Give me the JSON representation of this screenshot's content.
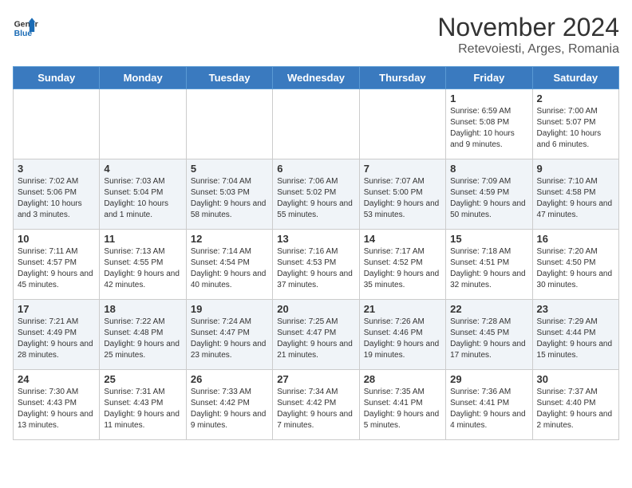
{
  "header": {
    "logo": {
      "general": "General",
      "blue": "Blue"
    },
    "title": "November 2024",
    "subtitle": "Retevoiesti, Arges, Romania"
  },
  "days_of_week": [
    "Sunday",
    "Monday",
    "Tuesday",
    "Wednesday",
    "Thursday",
    "Friday",
    "Saturday"
  ],
  "weeks": [
    [
      {
        "day": "",
        "info": ""
      },
      {
        "day": "",
        "info": ""
      },
      {
        "day": "",
        "info": ""
      },
      {
        "day": "",
        "info": ""
      },
      {
        "day": "",
        "info": ""
      },
      {
        "day": "1",
        "info": "Sunrise: 6:59 AM\nSunset: 5:08 PM\nDaylight: 10 hours and 9 minutes."
      },
      {
        "day": "2",
        "info": "Sunrise: 7:00 AM\nSunset: 5:07 PM\nDaylight: 10 hours and 6 minutes."
      }
    ],
    [
      {
        "day": "3",
        "info": "Sunrise: 7:02 AM\nSunset: 5:06 PM\nDaylight: 10 hours and 3 minutes."
      },
      {
        "day": "4",
        "info": "Sunrise: 7:03 AM\nSunset: 5:04 PM\nDaylight: 10 hours and 1 minute."
      },
      {
        "day": "5",
        "info": "Sunrise: 7:04 AM\nSunset: 5:03 PM\nDaylight: 9 hours and 58 minutes."
      },
      {
        "day": "6",
        "info": "Sunrise: 7:06 AM\nSunset: 5:02 PM\nDaylight: 9 hours and 55 minutes."
      },
      {
        "day": "7",
        "info": "Sunrise: 7:07 AM\nSunset: 5:00 PM\nDaylight: 9 hours and 53 minutes."
      },
      {
        "day": "8",
        "info": "Sunrise: 7:09 AM\nSunset: 4:59 PM\nDaylight: 9 hours and 50 minutes."
      },
      {
        "day": "9",
        "info": "Sunrise: 7:10 AM\nSunset: 4:58 PM\nDaylight: 9 hours and 47 minutes."
      }
    ],
    [
      {
        "day": "10",
        "info": "Sunrise: 7:11 AM\nSunset: 4:57 PM\nDaylight: 9 hours and 45 minutes."
      },
      {
        "day": "11",
        "info": "Sunrise: 7:13 AM\nSunset: 4:55 PM\nDaylight: 9 hours and 42 minutes."
      },
      {
        "day": "12",
        "info": "Sunrise: 7:14 AM\nSunset: 4:54 PM\nDaylight: 9 hours and 40 minutes."
      },
      {
        "day": "13",
        "info": "Sunrise: 7:16 AM\nSunset: 4:53 PM\nDaylight: 9 hours and 37 minutes."
      },
      {
        "day": "14",
        "info": "Sunrise: 7:17 AM\nSunset: 4:52 PM\nDaylight: 9 hours and 35 minutes."
      },
      {
        "day": "15",
        "info": "Sunrise: 7:18 AM\nSunset: 4:51 PM\nDaylight: 9 hours and 32 minutes."
      },
      {
        "day": "16",
        "info": "Sunrise: 7:20 AM\nSunset: 4:50 PM\nDaylight: 9 hours and 30 minutes."
      }
    ],
    [
      {
        "day": "17",
        "info": "Sunrise: 7:21 AM\nSunset: 4:49 PM\nDaylight: 9 hours and 28 minutes."
      },
      {
        "day": "18",
        "info": "Sunrise: 7:22 AM\nSunset: 4:48 PM\nDaylight: 9 hours and 25 minutes."
      },
      {
        "day": "19",
        "info": "Sunrise: 7:24 AM\nSunset: 4:47 PM\nDaylight: 9 hours and 23 minutes."
      },
      {
        "day": "20",
        "info": "Sunrise: 7:25 AM\nSunset: 4:47 PM\nDaylight: 9 hours and 21 minutes."
      },
      {
        "day": "21",
        "info": "Sunrise: 7:26 AM\nSunset: 4:46 PM\nDaylight: 9 hours and 19 minutes."
      },
      {
        "day": "22",
        "info": "Sunrise: 7:28 AM\nSunset: 4:45 PM\nDaylight: 9 hours and 17 minutes."
      },
      {
        "day": "23",
        "info": "Sunrise: 7:29 AM\nSunset: 4:44 PM\nDaylight: 9 hours and 15 minutes."
      }
    ],
    [
      {
        "day": "24",
        "info": "Sunrise: 7:30 AM\nSunset: 4:43 PM\nDaylight: 9 hours and 13 minutes."
      },
      {
        "day": "25",
        "info": "Sunrise: 7:31 AM\nSunset: 4:43 PM\nDaylight: 9 hours and 11 minutes."
      },
      {
        "day": "26",
        "info": "Sunrise: 7:33 AM\nSunset: 4:42 PM\nDaylight: 9 hours and 9 minutes."
      },
      {
        "day": "27",
        "info": "Sunrise: 7:34 AM\nSunset: 4:42 PM\nDaylight: 9 hours and 7 minutes."
      },
      {
        "day": "28",
        "info": "Sunrise: 7:35 AM\nSunset: 4:41 PM\nDaylight: 9 hours and 5 minutes."
      },
      {
        "day": "29",
        "info": "Sunrise: 7:36 AM\nSunset: 4:41 PM\nDaylight: 9 hours and 4 minutes."
      },
      {
        "day": "30",
        "info": "Sunrise: 7:37 AM\nSunset: 4:40 PM\nDaylight: 9 hours and 2 minutes."
      }
    ]
  ]
}
